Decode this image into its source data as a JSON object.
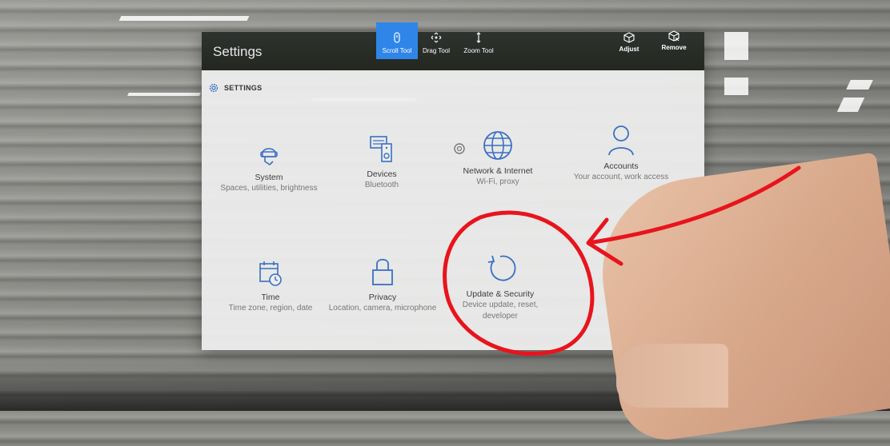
{
  "window": {
    "title": "Settings",
    "toolbar": {
      "tools": [
        {
          "label": "Scroll Tool",
          "icon": "scroll-icon",
          "active": true
        },
        {
          "label": "Drag Tool",
          "icon": "drag-icon",
          "active": false
        },
        {
          "label": "Zoom Tool",
          "icon": "zoom-icon",
          "active": false
        }
      ],
      "adjust_label": "Adjust",
      "remove_label": "Remove"
    },
    "header": {
      "icon": "gear-icon",
      "label": "SETTINGS"
    }
  },
  "tiles": [
    {
      "icon": "mixed-reality-icon",
      "title": "System",
      "subtitle": "Spaces, utilities, brightness"
    },
    {
      "icon": "devices-icon",
      "title": "Devices",
      "subtitle": "Bluetooth"
    },
    {
      "icon": "globe-icon",
      "title": "Network & Internet",
      "subtitle": "Wi-Fi, proxy"
    },
    {
      "icon": "person-icon",
      "title": "Accounts",
      "subtitle": "Your account, work access"
    },
    {
      "icon": "calendar-clock-icon",
      "title": "Time",
      "subtitle": "Time zone, region, date"
    },
    {
      "icon": "lock-icon",
      "title": "Privacy",
      "subtitle": "Location, camera, microphone"
    },
    {
      "icon": "refresh-icon",
      "title": "Update & Security",
      "subtitle": "Device update, reset, developer"
    }
  ],
  "colors": {
    "accent": "#2f86e8",
    "icon": "#3b6fc4",
    "titlebar": "#2a2e27",
    "annotation": "#e8141d"
  }
}
